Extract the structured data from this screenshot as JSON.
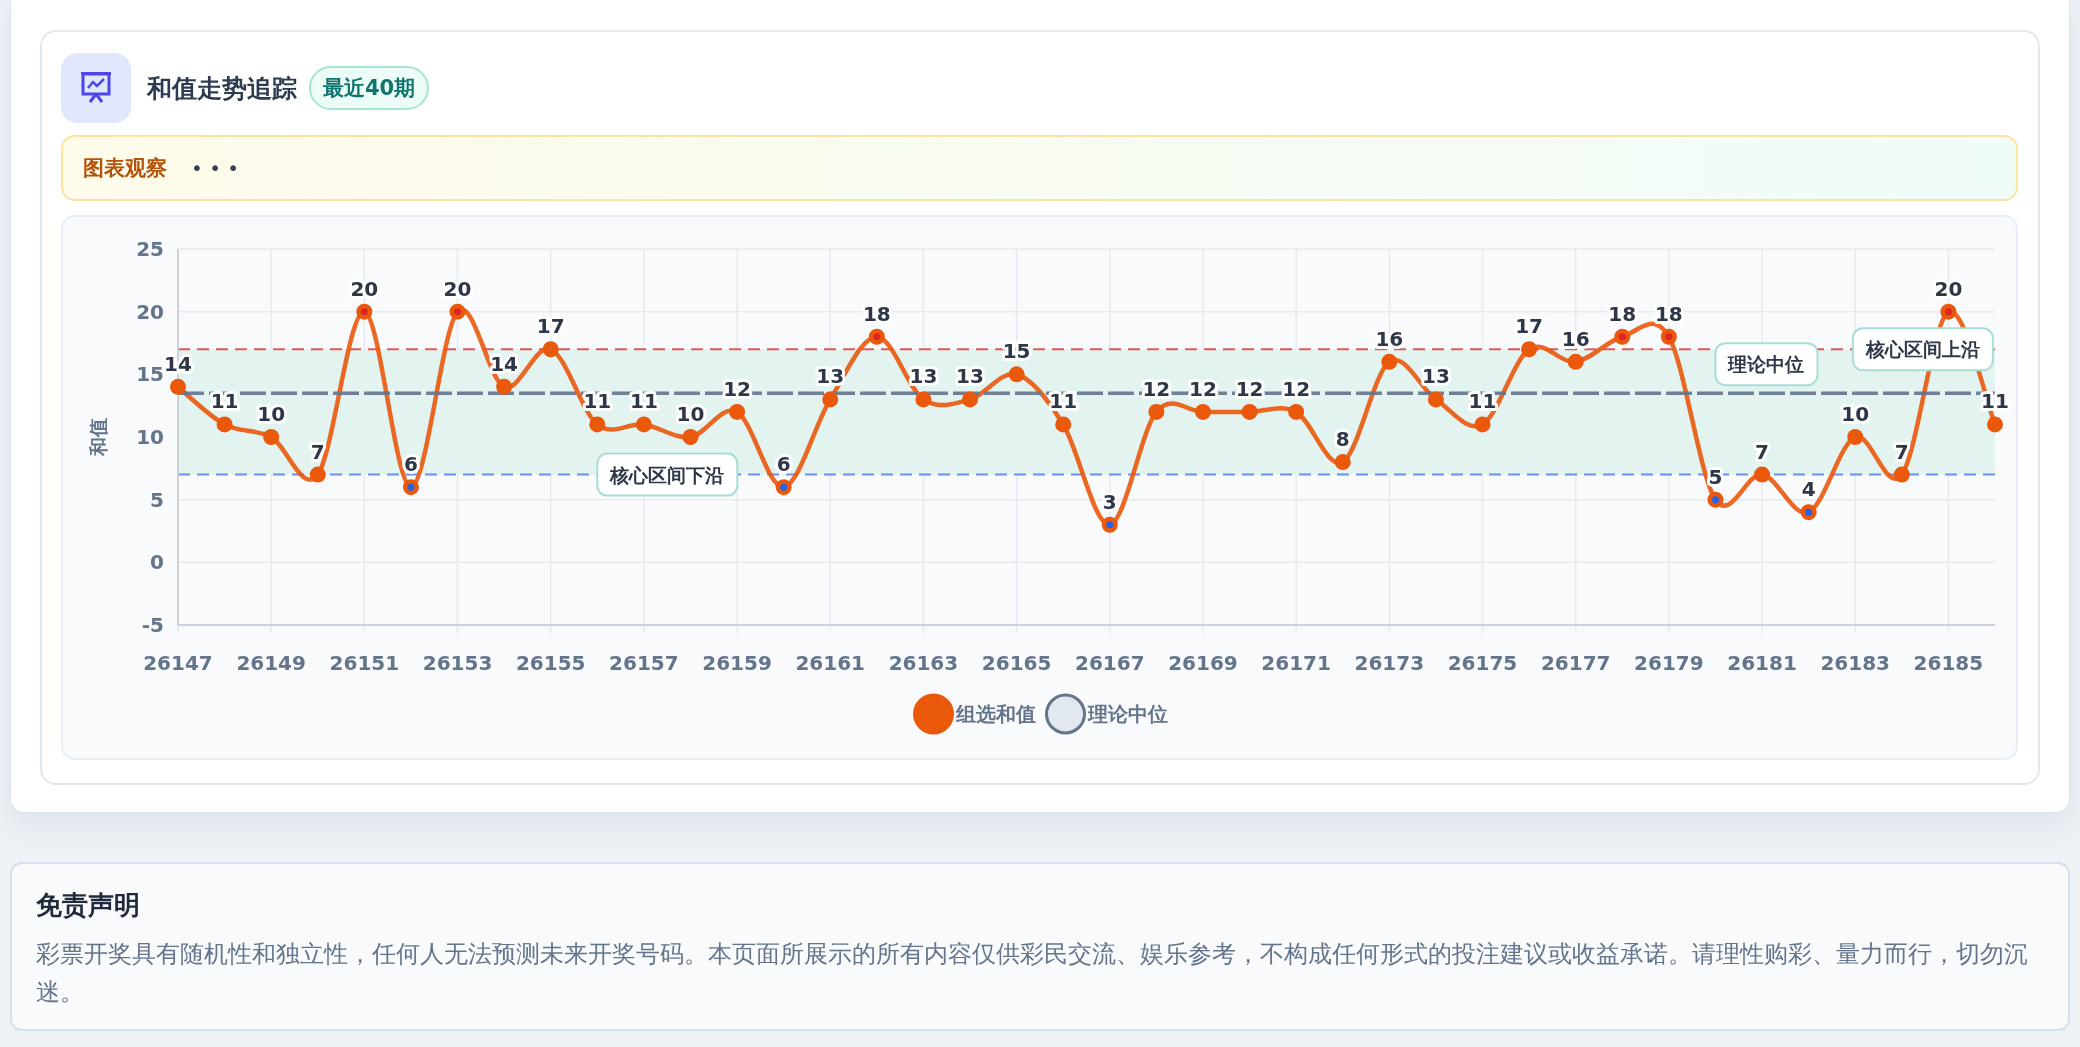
{
  "header": {
    "title": "和值走势追踪",
    "badge": "最近40期"
  },
  "observation": {
    "label": "图表观察",
    "dots": "• • •"
  },
  "chart": {
    "chart_data": {
      "type": "line",
      "ylabel": "和值",
      "x": [
        26147,
        26148,
        26149,
        26150,
        26151,
        26152,
        26153,
        26154,
        26155,
        26156,
        26157,
        26158,
        26159,
        26160,
        26161,
        26162,
        26163,
        26164,
        26165,
        26166,
        26167,
        26168,
        26169,
        26170,
        26171,
        26172,
        26173,
        26174,
        26175,
        26176,
        26177,
        26178,
        26179,
        26180,
        26181,
        26182,
        26183,
        26184,
        26185,
        26186
      ],
      "xlim": [
        26147,
        26186
      ],
      "xticks": [
        26147,
        26149,
        26151,
        26153,
        26155,
        26157,
        26159,
        26161,
        26163,
        26165,
        26167,
        26169,
        26171,
        26173,
        26175,
        26177,
        26179,
        26181,
        26183,
        26185
      ],
      "ylim": [
        -5,
        25
      ],
      "yticks": [
        -5,
        0,
        5,
        10,
        15,
        20,
        25
      ],
      "grid": true,
      "legend": true,
      "data_labels": "value_labels",
      "series": [
        {
          "name": "组选和值",
          "color": "#ea580c",
          "marker": "circle",
          "line_style": "solid",
          "value_labels": [
            "14",
            "11",
            "10",
            "7",
            "20",
            "6",
            "20",
            "14",
            "17",
            "11",
            "11",
            "10",
            "12",
            "6",
            "13",
            "18",
            "13",
            "13",
            "15",
            "11",
            "3",
            "12",
            "12",
            "12",
            "12",
            "8",
            "16",
            "13",
            "11",
            "17",
            "16",
            "18",
            "18",
            "5",
            "7",
            "4",
            "10",
            "7",
            "20",
            "11"
          ],
          "values": [
            14,
            11,
            10,
            7,
            20,
            6,
            20,
            14,
            17,
            11,
            11,
            10,
            12,
            6,
            13,
            18,
            13,
            13,
            15,
            11,
            3,
            12,
            12,
            12,
            12,
            8,
            16,
            13,
            11,
            17,
            16,
            18,
            18,
            5,
            7,
            4,
            10,
            7,
            20,
            11
          ]
        },
        {
          "name": "理论中位",
          "color": "#64748b",
          "line_style": "dashed",
          "values": [
            13.5,
            13.5,
            13.5,
            13.5,
            13.5,
            13.5,
            13.5,
            13.5,
            13.5,
            13.5,
            13.5,
            13.5,
            13.5,
            13.5,
            13.5,
            13.5,
            13.5,
            13.5,
            13.5,
            13.5,
            13.5,
            13.5,
            13.5,
            13.5,
            13.5,
            13.5,
            13.5,
            13.5,
            13.5,
            13.5,
            13.5,
            13.5,
            13.5,
            13.5,
            13.5,
            13.5,
            13.5,
            13.5,
            13.5,
            13.5
          ]
        }
      ],
      "ref_lines": [
        {
          "axis": "y",
          "value": 17,
          "label": "核心区间上沿",
          "color": "#e05a5a"
        },
        {
          "axis": "y",
          "value": 7,
          "label": "核心区间下沿",
          "color": "#6b90f0"
        }
      ],
      "annotations": [
        {
          "text": "理论中位",
          "y": 13.5
        }
      ]
    }
  },
  "disclaimer": {
    "title": "免责声明",
    "text": "彩票开奖具有随机性和独立性，任何人无法预测未来开奖号码。本页面所展示的所有内容仅供彩民交流、娱乐参考，不构成任何形式的投注建议或收益承诺。请理性购彩、量力而行，切勿沉迷。"
  }
}
